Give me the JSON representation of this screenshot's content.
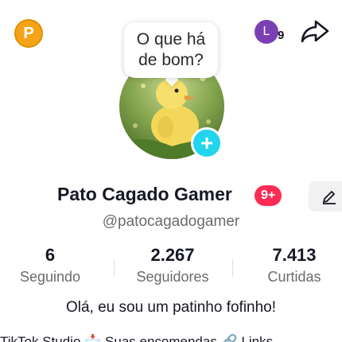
{
  "header": {
    "coin_label": "P",
    "avatar_initial": "L",
    "notif_count": "9"
  },
  "bubble": {
    "line1": "O que há",
    "line2": "de bom?"
  },
  "profile": {
    "name": "Pato Cagado Gamer",
    "badge": "9+",
    "handle": "@patocagadogamer",
    "bio": "Olá, eu sou um patinho fofinho!"
  },
  "stats": [
    {
      "value": "6",
      "label": "Seguindo"
    },
    {
      "value": "2.267",
      "label": "Seguidores"
    },
    {
      "value": "7.413",
      "label": "Curtidas"
    }
  ],
  "bottom_links": "TikTok Studio   📩 Suas encomendas   🔗 Links",
  "colors": {
    "accent_pink": "#fe2c55",
    "add_button": "#20d5ec",
    "coin": "#f6a417",
    "avatar_bg": "#7b3fb4"
  }
}
